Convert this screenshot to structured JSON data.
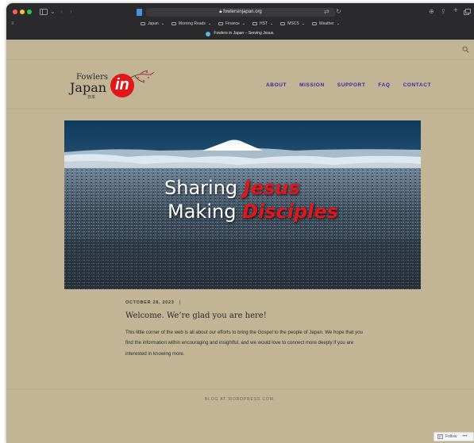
{
  "browser": {
    "url": "fowlersinjapan.org",
    "bookmarks": [
      {
        "label": "Japan"
      },
      {
        "label": "Morning Reads"
      },
      {
        "label": "Finance"
      },
      {
        "label": "HST"
      },
      {
        "label": "MSCS"
      },
      {
        "label": "Weather"
      }
    ],
    "active_tab_title": "Fowlers in Japan – Serving Jesus."
  },
  "site": {
    "logo": {
      "line1": "Fowlers",
      "line2": "Japan",
      "badge": "in",
      "small": "日本"
    },
    "nav": [
      {
        "label": "ABOUT"
      },
      {
        "label": "MISSION"
      },
      {
        "label": "SUPPORT"
      },
      {
        "label": "FAQ"
      },
      {
        "label": "CONTACT"
      }
    ],
    "hero": {
      "line1_white": "Sharing",
      "line1_red": "Jesus",
      "line2_white": "Making",
      "line2_red": "Disciples"
    },
    "post": {
      "date": "OCTOBER 28, 2023",
      "separator": "|",
      "title": "Welcome. We’re glad you are here!",
      "body": "This little corner of the web is all about our efforts to bring the Gospel to the people of Japan. We hope that you find the information within encouraging and insightful, and we would love to connect more deeply if you are interested in knowing more."
    },
    "footer": "BLOG AT WORDPRESS.COM.",
    "follow": {
      "label": "Follow",
      "more": "•••"
    }
  },
  "colors": {
    "page_bg": "#c2b595",
    "nav_link": "#3a24a8",
    "brand_red": "#e3161c"
  }
}
